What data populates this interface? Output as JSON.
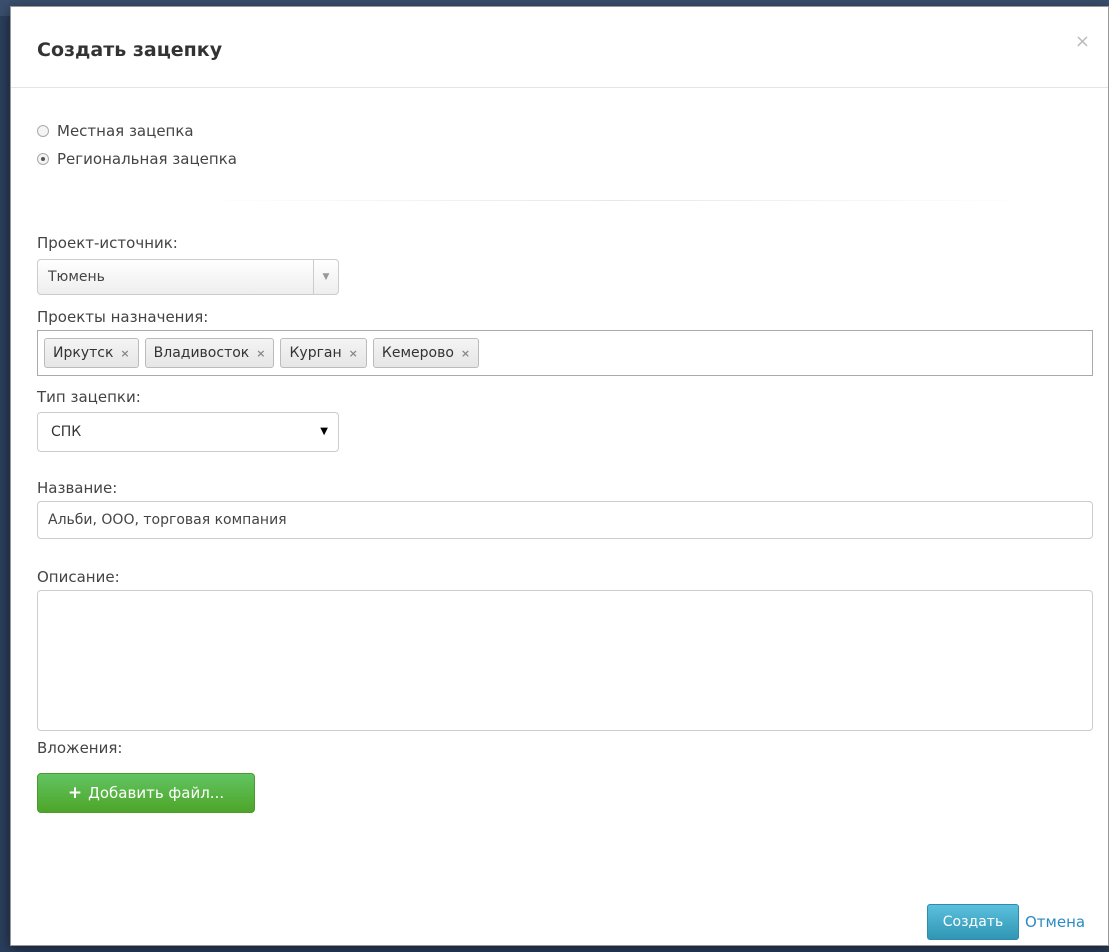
{
  "dialog": {
    "title": "Создать зацепку",
    "close_glyph": "×"
  },
  "scope": {
    "options": [
      {
        "label": "Местная зацепка",
        "checked": false
      },
      {
        "label": "Региональная зацепка",
        "checked": true
      }
    ]
  },
  "source_project": {
    "label": "Проект-источник:",
    "value": "Тюмень"
  },
  "target_projects": {
    "label": "Проекты назначения:",
    "tags": [
      "Иркутск",
      "Владивосток",
      "Курган",
      "Кемерово"
    ],
    "remove_glyph": "×"
  },
  "lead_type": {
    "label": "Тип зацепки:",
    "value": "СПК"
  },
  "name": {
    "label": "Название:",
    "value": "Альби, ООО, торговая компания"
  },
  "description": {
    "label": "Описание:",
    "value": ""
  },
  "attachments": {
    "label": "Вложения:",
    "add_button_label": "Добавить файл..."
  },
  "footer": {
    "create_label": "Создать",
    "cancel_label": "Отмена"
  },
  "colors": {
    "add_button": "#5cb85c",
    "create_button": "#49afcd",
    "cancel_link": "#2a8ac4"
  }
}
